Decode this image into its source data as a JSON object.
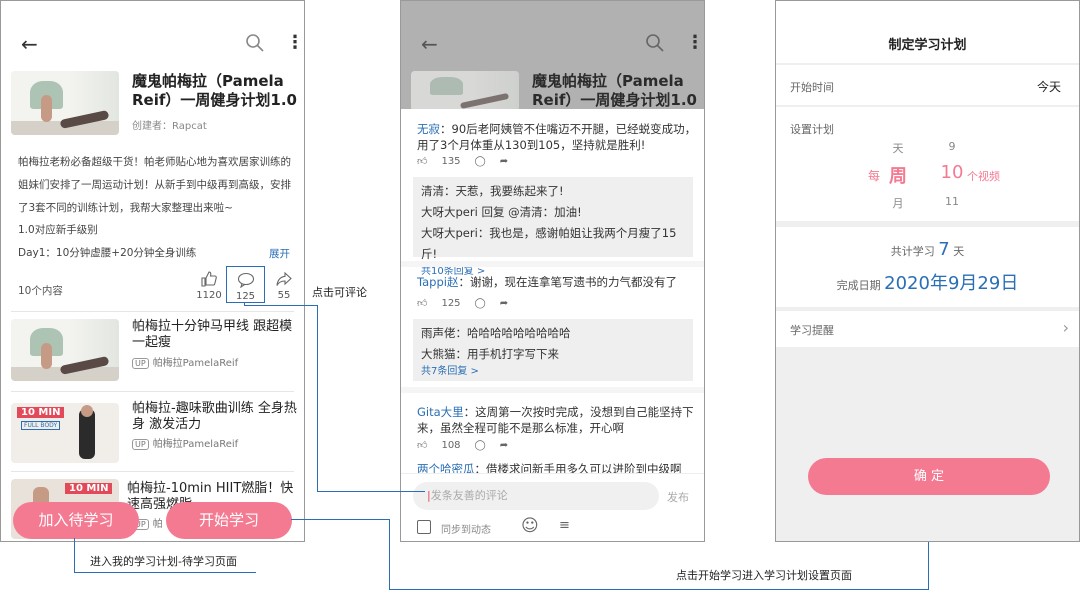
{
  "screen1": {
    "course_title": "魔鬼帕梅拉（Pamela Reif）一周健身计划1.0",
    "creator": "创建者：Rapcat",
    "description_lines": [
      "帕梅拉老粉必备超级干货！帕老师贴心地为喜欢居家训练的",
      "姐妹们安排了一周运动计划！从新手到中级再到高级，安排",
      "了3套不同的训练计划，我帮大家整理出来啦~",
      "1.0对应新手级别"
    ],
    "day1": "Day1：10分钟虚腰+20分钟全身训练",
    "expand": "展开",
    "content_count": "10个内容",
    "likes": "1120",
    "comments": "125",
    "shares": "55",
    "items": [
      {
        "title": "帕梅拉十分钟马甲线 跟超模一起瘦",
        "author": "帕梅拉PamelaReif",
        "badge": "UP"
      },
      {
        "title": "帕梅拉-趣味歌曲训练 全身热身 激发活力",
        "author": "帕梅拉PamelaReif",
        "badge": "UP",
        "thumb_tag": "10 MIN",
        "thumb_sub": "FULL BODY"
      },
      {
        "title": "帕梅拉-10min HIIT燃脂！快速高强燃脂",
        "author": "帕",
        "badge": "UP",
        "thumb_tag": "10 MIN"
      }
    ],
    "btn_add": "加入待学习",
    "btn_start": "开始学习"
  },
  "screen2": {
    "comments": [
      {
        "user": "无寂",
        "text": "：90后老阿姨管不住嘴迈不开腿，已经蜕变成功，用了3个月体重从130到105，坚持就是胜利!",
        "likes": "135",
        "replies": [
          {
            "user": "清清",
            "text": "：天惹，我要练起来了!"
          },
          {
            "user": "大呀大peri",
            "text": " 回复 ",
            "target": "@清清",
            "text2": "：加油!"
          },
          {
            "user": "大呀大peri",
            "text": "：我也是，感谢帕姐让我两个月瘦了15斤!"
          }
        ],
        "more": "共10条回复 >"
      },
      {
        "user": "Tappi赵",
        "text": "：谢谢，现在连拿笔写遗书的力气都没有了",
        "likes": "125",
        "replies": [
          {
            "user": "雨声佬",
            "text": "：哈哈哈哈哈哈哈哈哈"
          },
          {
            "user": "大熊猫",
            "text": "：用手机打字写下来"
          }
        ],
        "more": "共7条回复 >"
      },
      {
        "user": "Gita大里",
        "text": "：这周第一次按时完成，没想到自己能坚持下来，虽然全程可能不是那么标准，开心啊",
        "likes": "108"
      },
      {
        "user": "两个哈密瓜",
        "text": "：借楼求问新手用多久可以进阶到中级啊"
      }
    ],
    "input_placeholder": "发条友善的评论",
    "publish": "发布",
    "sync": "同步到动态"
  },
  "screen3": {
    "title": "制定学习计划",
    "start_label": "开始时间",
    "start_value": "今天",
    "plan_label": "设置计划",
    "picker_left": [
      "天",
      "周",
      "月"
    ],
    "picker_right": [
      "9",
      "10",
      "11"
    ],
    "every": "每",
    "videos": "个视频",
    "total_prefix": "共计学习",
    "total_num": "7",
    "total_unit": "天",
    "finish_label": "完成日期",
    "finish_date": "2020年9月29日",
    "reminder": "学习提醒",
    "confirm": "确 定"
  },
  "annotations": {
    "click_comment": "点击可评论",
    "add_to_plan": "进入我的学习计划-待学习页面",
    "start_to_plan": "点击开始学习进入学习计划设置页面"
  },
  "colors": {
    "accent": "#f47a92",
    "link": "#2a6fb6"
  }
}
